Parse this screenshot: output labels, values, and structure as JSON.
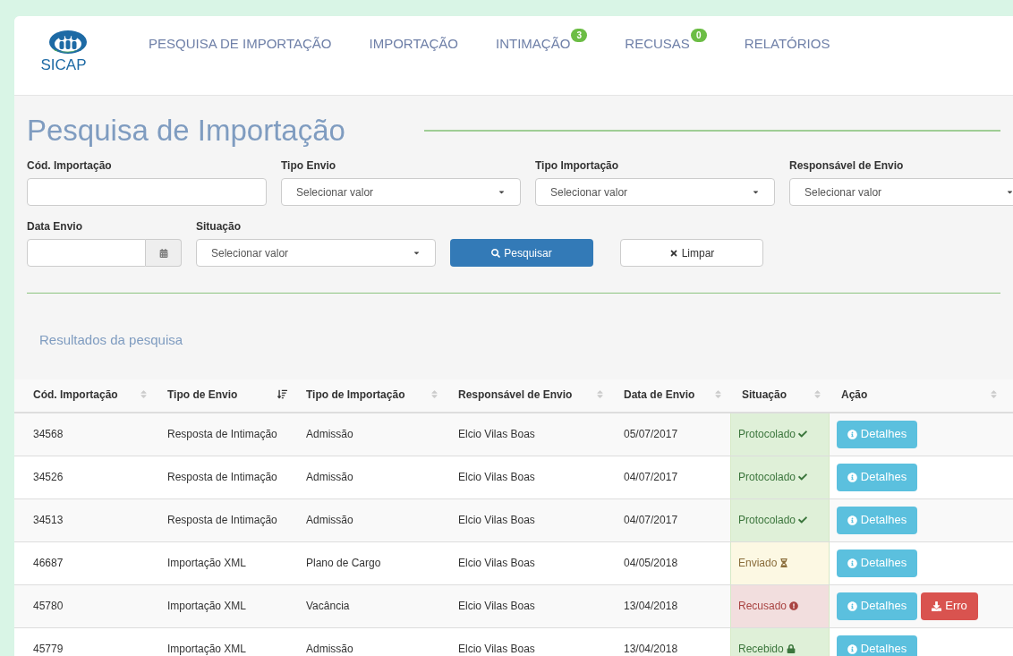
{
  "logo": {
    "text": "SICAP"
  },
  "nav": [
    {
      "label": "PESQUISA DE IMPORTAÇÃO"
    },
    {
      "label": "IMPORTAÇÃO"
    },
    {
      "label": "INTIMAÇÃO",
      "badge": "3"
    },
    {
      "label": "RECUSAS",
      "badge": "0"
    },
    {
      "label": "RELATÓRIOS"
    }
  ],
  "page_title": "Pesquisa de Importação",
  "filters": [
    {
      "kind": "text",
      "label": "Cód. Importação"
    },
    {
      "kind": "select",
      "label": "Tipo Envio",
      "value": "Selecionar valor"
    },
    {
      "kind": "select",
      "label": "Tipo Importação",
      "value": "Selecionar valor"
    },
    {
      "kind": "select",
      "label": "Responsável de Envio",
      "value": "Selecionar valor"
    },
    {
      "kind": "date",
      "label": "Data Envio"
    },
    {
      "kind": "select",
      "label": "Situação",
      "value": "Selecionar valor"
    }
  ],
  "buttons": [
    {
      "kind": "search",
      "label": "Pesquisar"
    },
    {
      "kind": "clear",
      "label": "Limpar"
    }
  ],
  "results_title": "Resultados da pesquisa",
  "table": {
    "columns": [
      {
        "label": "Cód. Importação",
        "sorted": false
      },
      {
        "label": "Tipo de Envio",
        "sorted": true
      },
      {
        "label": "Tipo de Importação",
        "sorted": false
      },
      {
        "label": "Responsável de Envio",
        "sorted": false
      },
      {
        "label": "Data de Envio",
        "sorted": false
      },
      {
        "label": "Situação",
        "sorted": false
      },
      {
        "label": "Ação",
        "sorted": false
      }
    ],
    "rows": [
      {
        "code": "34568",
        "tipo_envio": "Resposta de Intimação",
        "tipo_importacao": "Admissão",
        "responsavel": "Elcio Vilas Boas",
        "data": "05/07/2017",
        "status": {
          "kind": "protocolado",
          "label": "Protocolado"
        },
        "actions": [
          {
            "kind": "info",
            "label": "Detalhes"
          }
        ]
      },
      {
        "code": "34526",
        "tipo_envio": "Resposta de Intimação",
        "tipo_importacao": "Admissão",
        "responsavel": "Elcio Vilas Boas",
        "data": "04/07/2017",
        "status": {
          "kind": "protocolado",
          "label": "Protocolado"
        },
        "actions": [
          {
            "kind": "info",
            "label": "Detalhes"
          }
        ]
      },
      {
        "code": "34513",
        "tipo_envio": "Resposta de Intimação",
        "tipo_importacao": "Admissão",
        "responsavel": "Elcio Vilas Boas",
        "data": "04/07/2017",
        "status": {
          "kind": "protocolado",
          "label": "Protocolado"
        },
        "actions": [
          {
            "kind": "info",
            "label": "Detalhes"
          }
        ]
      },
      {
        "code": "46687",
        "tipo_envio": "Importação XML",
        "tipo_importacao": "Plano de Cargo",
        "responsavel": "Elcio Vilas Boas",
        "data": "04/05/2018",
        "status": {
          "kind": "enviado",
          "label": "Enviado"
        },
        "actions": [
          {
            "kind": "info",
            "label": "Detalhes"
          }
        ]
      },
      {
        "code": "45780",
        "tipo_envio": "Importação XML",
        "tipo_importacao": "Vacância",
        "responsavel": "Elcio Vilas Boas",
        "data": "13/04/2018",
        "status": {
          "kind": "recusado",
          "label": "Recusado"
        },
        "actions": [
          {
            "kind": "info",
            "label": "Detalhes"
          },
          {
            "kind": "error",
            "label": "Erro"
          }
        ]
      },
      {
        "code": "45779",
        "tipo_envio": "Importação XML",
        "tipo_importacao": "Admissão",
        "responsavel": "Elcio Vilas Boas",
        "data": "13/04/2018",
        "status": {
          "kind": "recebido",
          "label": "Recebido"
        },
        "actions": [
          {
            "kind": "info",
            "label": "Detalhes"
          }
        ]
      }
    ]
  }
}
